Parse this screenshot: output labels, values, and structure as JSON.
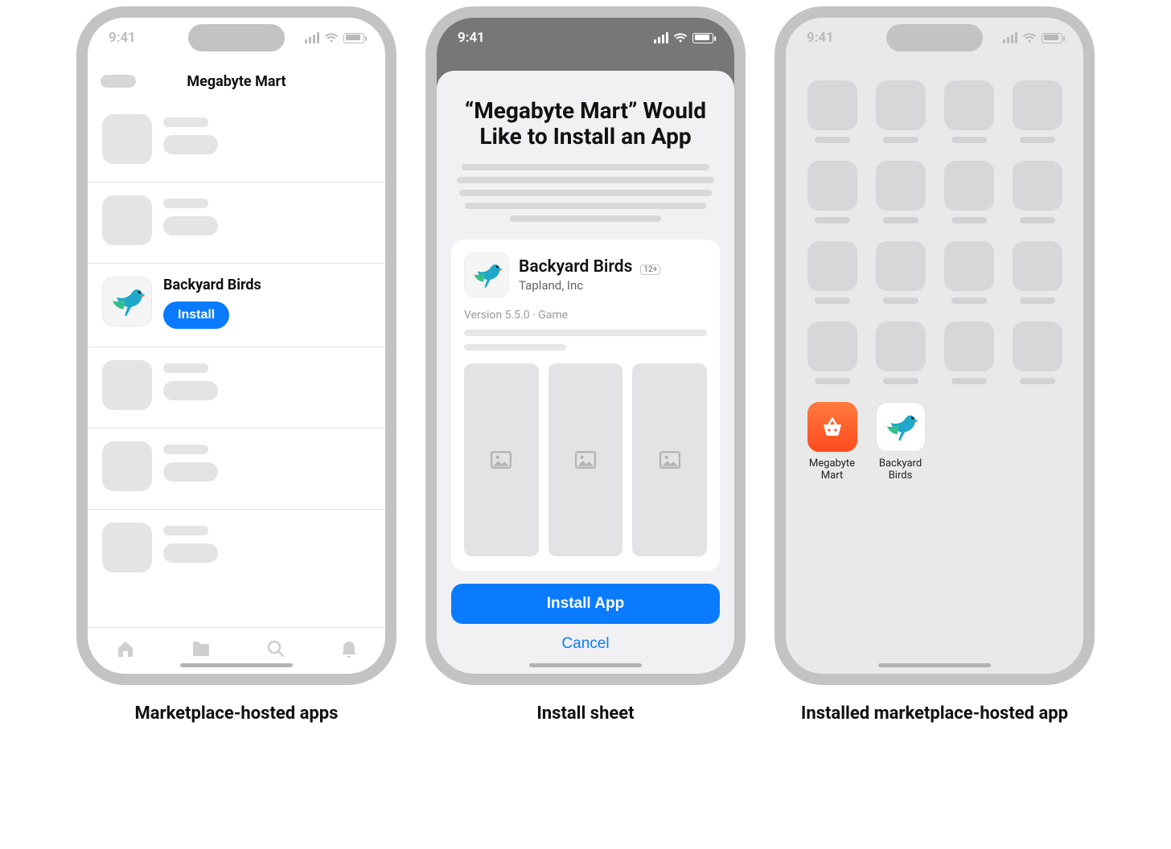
{
  "status": {
    "time": "9:41"
  },
  "captions": {
    "screen1": "Marketplace-hosted apps",
    "screen2": "Install sheet",
    "screen3": "Installed marketplace-hosted app"
  },
  "screen1": {
    "navTitle": "Megabyte Mart",
    "app": {
      "name": "Backyard Birds",
      "installLabel": "Install"
    }
  },
  "screen2": {
    "title": "“Megabyte Mart” Would Like to Install an App",
    "app": {
      "name": "Backyard Birds",
      "ageBadge": "12+",
      "developer": "Tapland, Inc",
      "meta": "Version 5.5.0 · Game"
    },
    "primary": "Install App",
    "cancel": "Cancel"
  },
  "screen3": {
    "apps": [
      {
        "name": "Megabyte Mart"
      },
      {
        "name": "Backyard Birds"
      }
    ]
  }
}
